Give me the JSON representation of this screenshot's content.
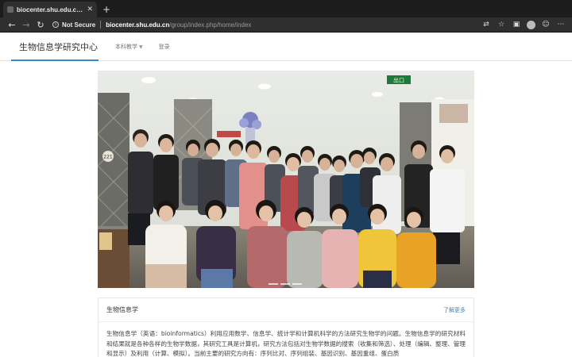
{
  "browser": {
    "tab_title": "biocenter.shu.edu.cn/group/in",
    "tab_close": "✕",
    "new_tab": "+",
    "security_label": "Not Secure",
    "url_host": "biocenter.shu.edu.cn",
    "url_path": "/group/index.php/home/index"
  },
  "site": {
    "brand": "生物信息学研究中心",
    "menu": [
      {
        "label": "本科教学",
        "has_dropdown": true
      },
      {
        "label": "登录"
      }
    ]
  },
  "card": {
    "title": "生物信息学",
    "more_link": "了解更多",
    "body": "生物信息学（英语：bioinformatics）利用应用数学、信息学、统计学和计算机科学的方法研究生物学的问题。生物信息学的研究材料和结果就是各种各样的生物学数据，其研究工具是计算机，研究方法包括对生物学数据的搜索（收集和筛选）、处理（编辑、整理、管理和显示）及利用（计算、模拟）。当前主要的研究方向有：序列比对、序列组装、基因识别、基因重组、蛋白质"
  },
  "hero_photo": {
    "sign_text": "出口",
    "plaque_number": "221"
  },
  "colors": {
    "accent": "#3a87c8",
    "tab_bg": "#2f2f2f",
    "chrome_bg": "#1c1c1c"
  },
  "icons": [
    "back-icon",
    "forward-icon",
    "reload-icon",
    "info-icon",
    "translate-icon",
    "star-icon",
    "extension-icon",
    "profile-icon",
    "smiley-icon",
    "more-icon"
  ]
}
